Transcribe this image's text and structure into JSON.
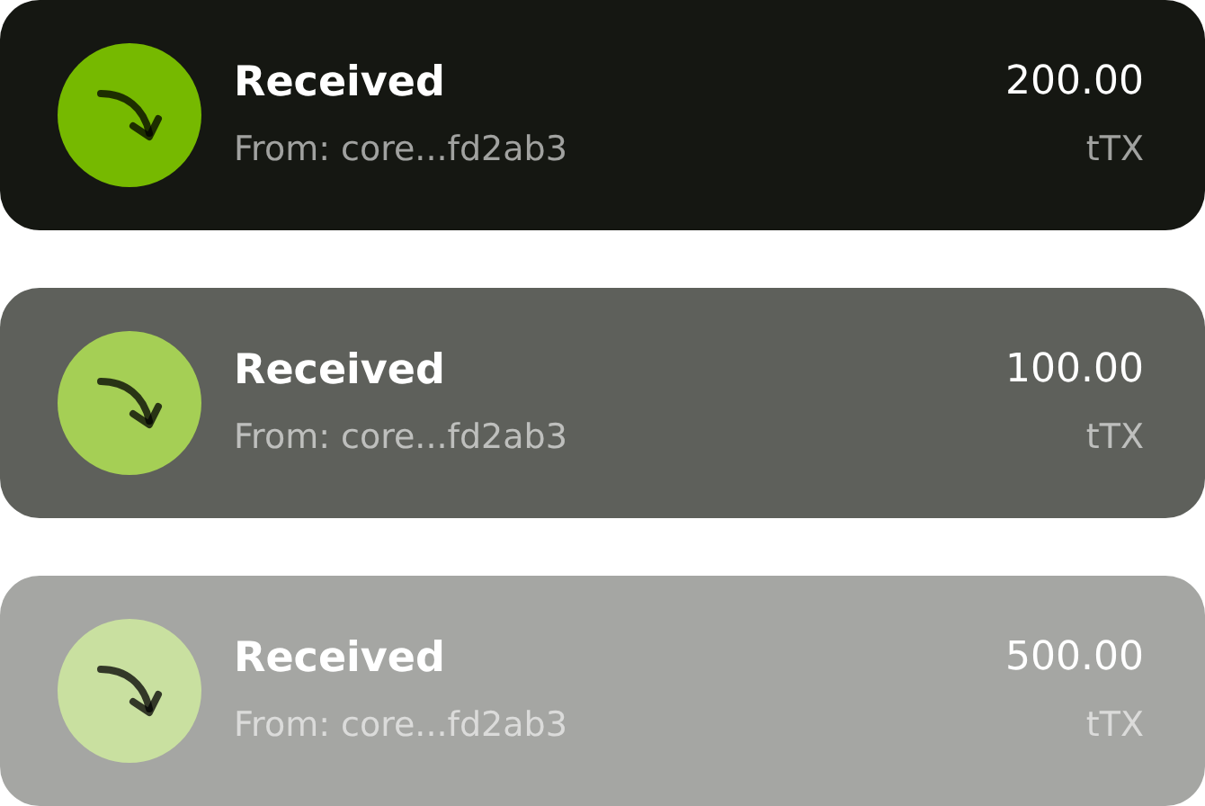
{
  "transactions": [
    {
      "title": "Received",
      "subtitle": "From: core...fd2ab3",
      "amount": "200.00",
      "unit": "tTX",
      "color": "#151712",
      "icon": {
        "color": "#76b900"
      }
    },
    {
      "title": "Received",
      "subtitle": "From: core...fd2ab3",
      "amount": "100.00",
      "unit": "tTX",
      "color": "#5e605b",
      "icon": {
        "color": "#a5cf55"
      }
    },
    {
      "title": "Received",
      "subtitle": "From: core...fd2ab3",
      "amount": "500.00",
      "unit": "tTX",
      "color": "#a5a6a3",
      "icon": {
        "color": "#c9e0a0"
      }
    }
  ]
}
